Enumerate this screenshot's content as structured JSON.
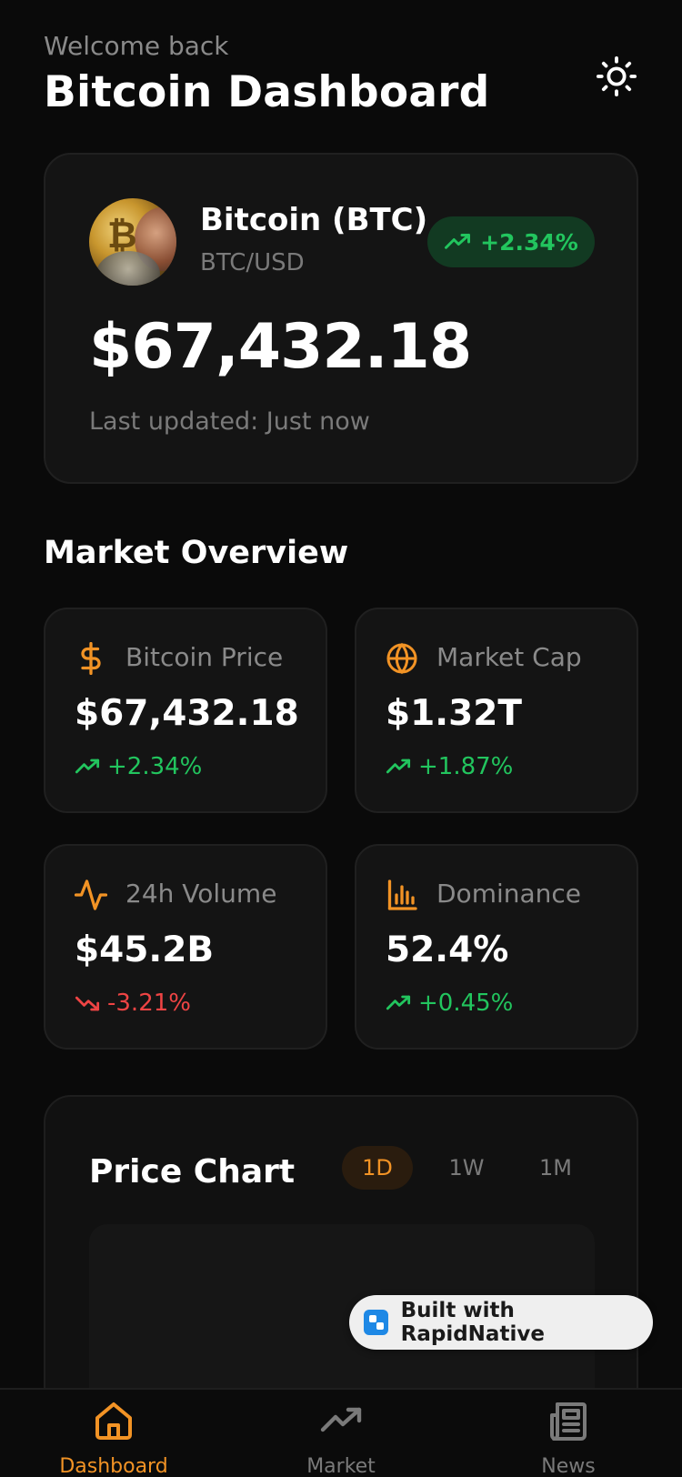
{
  "header": {
    "welcome": "Welcome back",
    "title": "Bitcoin Dashboard",
    "theme_icon": "sun-icon"
  },
  "hero": {
    "coin_name": "Bitcoin (BTC)",
    "pair": "BTC/USD",
    "change": "+2.34%",
    "price": "$67,432.18",
    "updated": "Last updated: Just now"
  },
  "market_overview": {
    "title": "Market Overview",
    "cards": [
      {
        "icon": "dollar-icon",
        "label": "Bitcoin Price",
        "value": "$67,432.18",
        "delta": "+2.34%",
        "trend": "up"
      },
      {
        "icon": "globe-icon",
        "label": "Market Cap",
        "value": "$1.32T",
        "delta": "+1.87%",
        "trend": "up"
      },
      {
        "icon": "activity-icon",
        "label": "24h Volume",
        "value": "$45.2B",
        "delta": "-3.21%",
        "trend": "down"
      },
      {
        "icon": "bar-chart-icon",
        "label": "Dominance",
        "value": "52.4%",
        "delta": "+0.45%",
        "trend": "up"
      }
    ]
  },
  "price_chart": {
    "title": "Price Chart",
    "ranges": [
      "1D",
      "1W",
      "1M"
    ],
    "active_range": "1D"
  },
  "badge": {
    "text": "Built with RapidNative"
  },
  "nav": {
    "items": [
      {
        "label": "Dashboard",
        "icon": "home-icon",
        "active": true
      },
      {
        "label": "Market",
        "icon": "trending-up-icon",
        "active": false
      },
      {
        "label": "News",
        "icon": "newspaper-icon",
        "active": false
      }
    ]
  },
  "colors": {
    "accent": "#f29325",
    "positive": "#22c55e",
    "negative": "#ef4444",
    "background": "#0a0a0a",
    "card": "#141414"
  }
}
